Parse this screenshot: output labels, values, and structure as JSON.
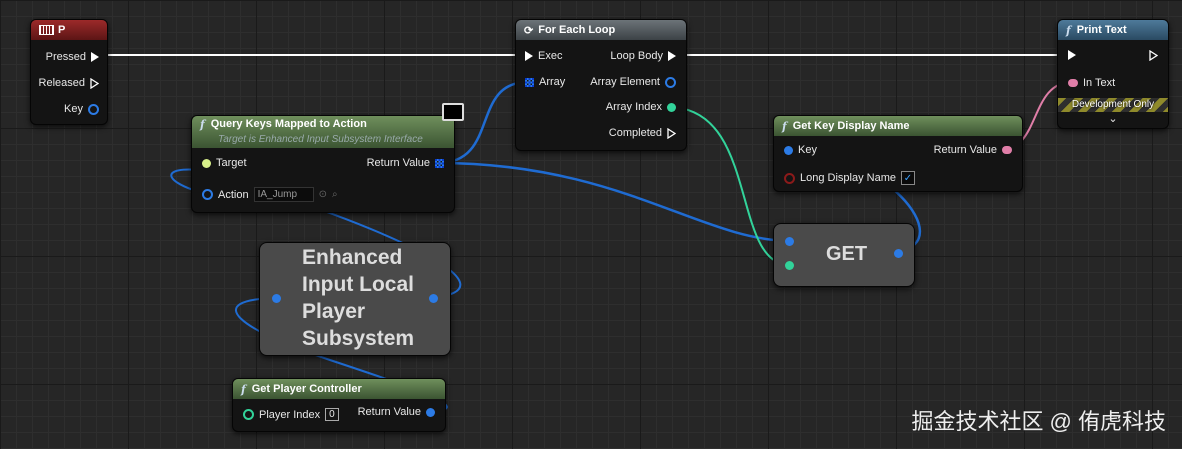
{
  "colors": {
    "event_header": "#8a1c1c",
    "loop_header": "#555b60",
    "function_header": "#4d6b45",
    "exec_wire": "#ffffff",
    "object_wire": "#1f6bd1",
    "int_wire": "#32d39a",
    "string_wire": "#e07ea8",
    "bool_pin": "#8b1a1a"
  },
  "event_p": {
    "title": "P",
    "pins": {
      "pressed": "Pressed",
      "released": "Released",
      "key": "Key"
    }
  },
  "foreach": {
    "title": "For Each Loop",
    "pins": {
      "exec": "Exec",
      "array": "Array",
      "loop_body": "Loop Body",
      "array_element": "Array Element",
      "array_index": "Array Index",
      "completed": "Completed"
    }
  },
  "print_text": {
    "title": "Print Text",
    "pins": {
      "in_text": "In Text"
    },
    "dev_only": "Development Only",
    "expand": "⌄"
  },
  "query_keys": {
    "title": "Query Keys Mapped to Action",
    "subtitle": "Target is Enhanced Input Subsystem Interface",
    "pins": {
      "target": "Target",
      "return": "Return Value",
      "action": "Action"
    },
    "action_value": "IA_Jump"
  },
  "get_key_display": {
    "title": "Get Key Display Name",
    "pins": {
      "key": "Key",
      "return": "Return Value",
      "long": "Long Display Name"
    },
    "long_checked": "✓"
  },
  "get_node": {
    "label": "GET"
  },
  "subsystem": {
    "label": "Enhanced Input Local Player Subsystem"
  },
  "get_player_controller": {
    "title": "Get Player Controller",
    "pins": {
      "index": "Player Index",
      "return": "Return Value"
    },
    "index_value": "0"
  },
  "watermark": "掘金技术社区 @ 侑虎科技"
}
